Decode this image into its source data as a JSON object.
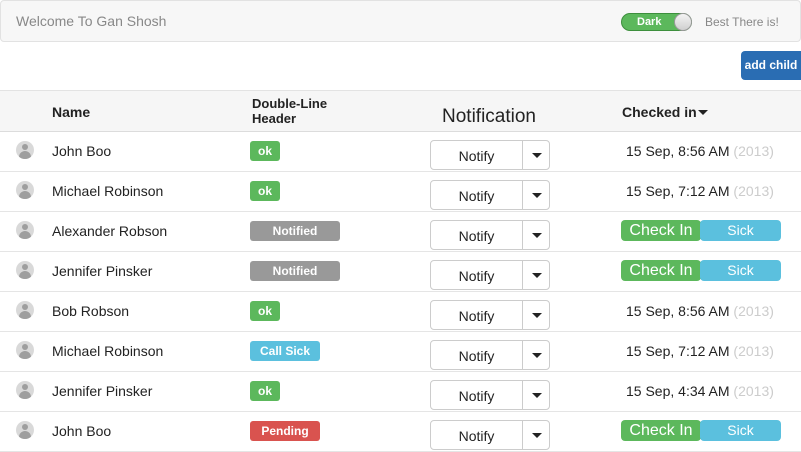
{
  "navbar": {
    "brand": "Welcome To Gan Shosh",
    "theme_toggle": "Dark",
    "tagline": "Best There is!"
  },
  "toolbar": {
    "add_child_label": "add child"
  },
  "table": {
    "headers": {
      "name": "Name",
      "status_line1": "Double-Line",
      "status_line2": "Header",
      "notification": "Notification",
      "checked_in": "Checked in"
    },
    "rows": [
      {
        "name": "John Boo",
        "status": "ok",
        "notify": "Notify",
        "checked_in": "15 Sep, 8:56 AM",
        "year": "(2013)"
      },
      {
        "name": "Michael Robinson",
        "status": "ok",
        "notify": "Notify",
        "checked_in": "15 Sep, 7:12 AM",
        "year": "(2013)"
      },
      {
        "name": "Alexander Robson",
        "status": "Notified",
        "notify": "Notify",
        "check_in_label": "Check In",
        "sick_label": "Sick"
      },
      {
        "name": "Jennifer Pinsker",
        "status": "Notified",
        "notify": "Notify",
        "check_in_label": "Check In",
        "sick_label": "Sick"
      },
      {
        "name": "Bob Robson",
        "status": "ok",
        "notify": "Notify",
        "checked_in": "15 Sep, 8:56 AM",
        "year": "(2013)"
      },
      {
        "name": "Michael Robinson",
        "status": "Call Sick",
        "notify": "Notify",
        "checked_in": "15 Sep, 7:12 AM",
        "year": "(2013)"
      },
      {
        "name": "Jennifer Pinsker",
        "status": "ok",
        "notify": "Notify",
        "checked_in": "15 Sep, 4:34 AM",
        "year": "(2013)"
      },
      {
        "name": "John Boo",
        "status": "Pending",
        "notify": "Notify",
        "check_in_label": "Check In",
        "sick_label": "Sick"
      }
    ]
  },
  "colors": {
    "ok": "#5cb85c",
    "notified": "#999999",
    "call_sick": "#5bc0de",
    "pending": "#d9534f",
    "primary": "#2a6db3"
  },
  "icons": {
    "avatar": "user-avatar-icon",
    "dropdown": "caret-down-icon"
  }
}
